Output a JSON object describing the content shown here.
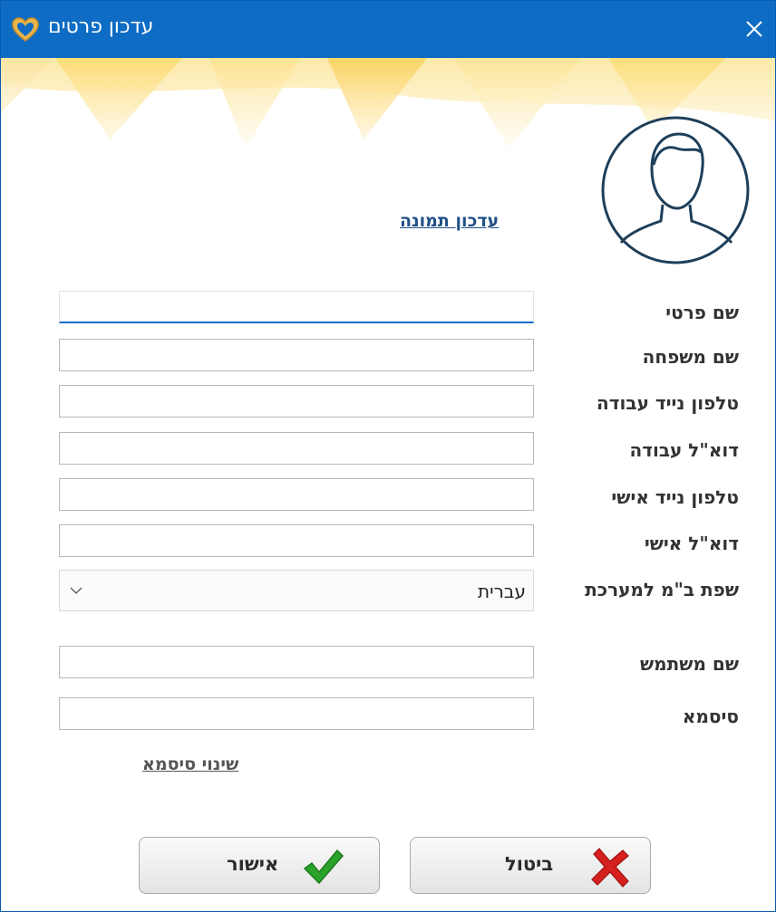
{
  "window": {
    "title": "עדכון פרטים",
    "title_bar_color": "#0e6cc4"
  },
  "icons": {
    "app": "heart-logo-icon",
    "close": "close-icon",
    "avatar": "user-avatar-icon",
    "dropdown": "chevron-down-icon",
    "confirm": "checkmark-icon",
    "cancel": "red-x-icon"
  },
  "profile": {
    "update_photo_link": "עדכון תמונה"
  },
  "fields": [
    {
      "label": "שם פרטי",
      "value": ""
    },
    {
      "label": "שם משפחה",
      "value": ""
    },
    {
      "label": "טלפון נייד עבודה",
      "value": ""
    },
    {
      "label": "דוא\"ל עבודה",
      "value": ""
    },
    {
      "label": "טלפון נייד אישי",
      "value": ""
    },
    {
      "label": "דוא\"ל אישי",
      "value": ""
    }
  ],
  "language": {
    "label": "שפת ב\"מ למערכת",
    "selected": "עברית"
  },
  "account": {
    "username_label": "שם משתמש",
    "username_value": "",
    "password_label": "סיסמא",
    "password_value": "",
    "change_password_link": "שינוי סיסמא"
  },
  "buttons": {
    "confirm_label": "אישור",
    "cancel_label": "ביטול"
  }
}
